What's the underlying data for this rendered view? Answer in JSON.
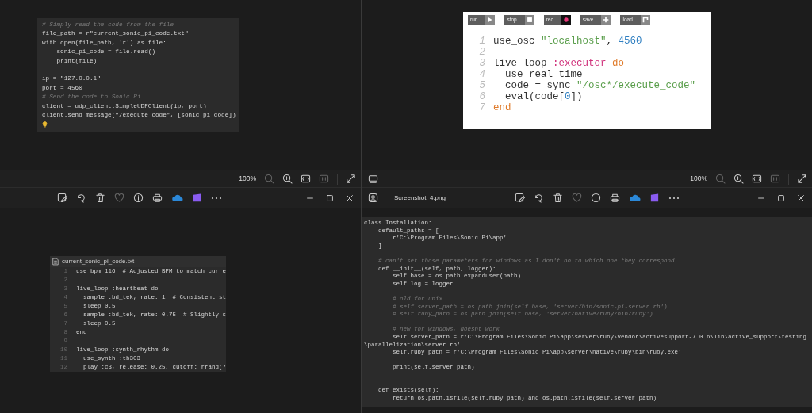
{
  "left_window": {
    "image_code": [
      {
        "kind": "comment",
        "text": "# Simply read the code from the file"
      },
      {
        "kind": "code",
        "text": "file_path = r\"current_sonic_pi_code.txt\""
      },
      {
        "kind": "code",
        "text": "with open(file_path, 'r') as file:"
      },
      {
        "kind": "code",
        "text": "    sonic_pi_code = file.read()"
      },
      {
        "kind": "code",
        "text": "    print(file)"
      },
      {
        "kind": "blank"
      },
      {
        "kind": "code",
        "text": "ip = \"127.0.0.1\""
      },
      {
        "kind": "code",
        "text": "port = 4560"
      },
      {
        "kind": "comment",
        "text": "# Send the code to Sonic Pi"
      },
      {
        "kind": "code",
        "text": "client = udp_client.SimpleUDPClient(ip, port)"
      },
      {
        "kind": "code",
        "text": "client.send_message(\"/execute_code\", [sonic_pi_code])"
      }
    ],
    "viewer_toolbar": {
      "zoom": "100%"
    },
    "file_panel": {
      "filename": "current_sonic_pi_code.txt",
      "lines": [
        {
          "number": "1",
          "text": "use_bpm 116  # Adjusted BPM to match curre"
        },
        {
          "number": "2"
        },
        {
          "number": "3",
          "text": "live_loop :heartbeat do"
        },
        {
          "number": "4",
          "text": "  sample :bd_tek, rate: 1  # Consistent st"
        },
        {
          "number": "5",
          "text": "  sleep 0.5"
        },
        {
          "number": "6",
          "text": "  sample :bd_tek, rate: 0.75  # Slightly s"
        },
        {
          "number": "7",
          "text": "  sleep 0.5"
        },
        {
          "number": "8",
          "text": "end"
        },
        {
          "number": "9"
        },
        {
          "number": "10",
          "text": "live_loop :synth_rhythm do"
        },
        {
          "number": "11",
          "text": "  use_synth :tb303"
        },
        {
          "number": "12",
          "text": "  play :c3, release: 0.25, cutoff: rrand(7"
        }
      ]
    }
  },
  "right_window": {
    "sonic_pi": {
      "buttons": [
        {
          "label": "run",
          "kind": "run"
        },
        {
          "label": "stop",
          "kind": "stop"
        },
        {
          "label": "rec",
          "kind": "rec"
        },
        {
          "label": "save",
          "kind": "save"
        },
        {
          "label": "load",
          "kind": "load"
        }
      ],
      "lines": [
        {
          "number": "1",
          "tokens": [
            {
              "kind": "plain",
              "text": "use_osc "
            },
            {
              "kind": "string",
              "text": "\"localhost\""
            },
            {
              "kind": "plain",
              "text": ", "
            },
            {
              "kind": "number",
              "text": "4560"
            }
          ]
        },
        {
          "number": "2"
        },
        {
          "number": "3",
          "tokens": [
            {
              "kind": "plain",
              "text": "live_loop "
            },
            {
              "kind": "symbol",
              "text": ":executor"
            },
            {
              "kind": "keyword",
              "text": " do"
            }
          ]
        },
        {
          "number": "4",
          "tokens": [
            {
              "kind": "plain",
              "text": "  use_real_time"
            }
          ]
        },
        {
          "number": "5",
          "tokens": [
            {
              "kind": "plain",
              "text": "  code = sync "
            },
            {
              "kind": "string",
              "text": "\"/osc*/execute_code\""
            }
          ]
        },
        {
          "number": "6",
          "tokens": [
            {
              "kind": "plain",
              "text": "  eval(code["
            },
            {
              "kind": "number",
              "text": "0"
            },
            {
              "kind": "plain",
              "text": "])"
            }
          ]
        },
        {
          "number": "7",
          "tokens": [
            {
              "kind": "keyword",
              "text": "end"
            }
          ]
        }
      ]
    },
    "viewer_toolbar": {
      "zoom": "100%"
    },
    "title_bar": {
      "filename": "Screenshot_4.png"
    },
    "code_lines": [
      {
        "kind": "code",
        "text": "class Installation:"
      },
      {
        "kind": "code",
        "text": "    default_paths = ["
      },
      {
        "kind": "code",
        "text": "        r'C:\\Program Files\\Sonic Pi\\app'"
      },
      {
        "kind": "code",
        "text": "    ]"
      },
      {
        "kind": "blank"
      },
      {
        "kind": "comment",
        "text": "    # can't set those parameters for windows as I don't no to which one they correspond"
      },
      {
        "kind": "code",
        "text": "    def __init__(self, path, logger):"
      },
      {
        "kind": "code",
        "text": "        self.base = os.path.expanduser(path)"
      },
      {
        "kind": "code",
        "text": "        self.log = logger"
      },
      {
        "kind": "blank"
      },
      {
        "kind": "comment",
        "text": "        # old for unix"
      },
      {
        "kind": "comment",
        "text": "        # self.server_path = os.path.join(self.base, 'server/bin/sonic-pi-server.rb')"
      },
      {
        "kind": "comment",
        "text": "        # self.ruby_path = os.path.join(self.base, 'server/native/ruby/bin/ruby')"
      },
      {
        "kind": "blank"
      },
      {
        "kind": "comment",
        "text": "        # new for windows, doesnt work"
      },
      {
        "kind": "code",
        "text": "        self.server_path = r'C:\\Program Files\\Sonic Pi\\app\\server\\ruby\\vendor\\activesupport-7.0.6\\lib\\active_support\\testing\\parallelization\\server.rb'"
      },
      {
        "kind": "code",
        "text": "        self.ruby_path = r'C:\\Program Files\\Sonic Pi\\app\\server\\native\\ruby\\bin\\ruby.exe'"
      },
      {
        "kind": "blank"
      },
      {
        "kind": "code",
        "text": "        print(self.server_path)"
      },
      {
        "kind": "blank"
      },
      {
        "kind": "blank"
      },
      {
        "kind": "code",
        "text": "    def exists(self):"
      },
      {
        "kind": "code",
        "text": "        return os.path.isfile(self.ruby_path) and os.path.isfile(self.server_path)"
      }
    ]
  }
}
